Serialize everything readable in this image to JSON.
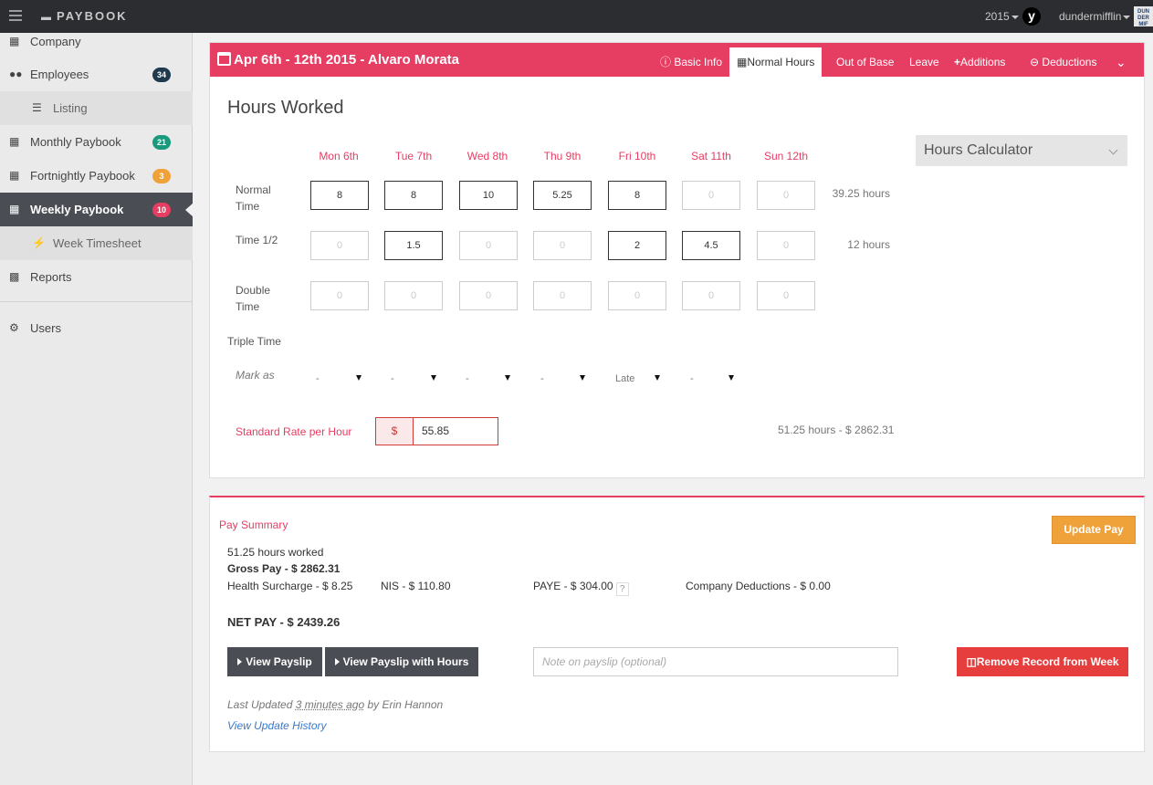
{
  "app": {
    "brand": "PAYBOOK",
    "year": "2015",
    "user": "dundermifflin",
    "company_logo_text": "DUNDER MIFFLIN"
  },
  "sidebar": {
    "items": [
      {
        "label": "Company",
        "icon": "building-icon"
      },
      {
        "label": "Employees",
        "icon": "users-icon",
        "badge": "34",
        "badge_color": "#1f3a4d"
      },
      {
        "label": "Listing",
        "icon": "list-icon"
      },
      {
        "label": "Monthly Paybook",
        "icon": "calendar-icon",
        "badge": "21",
        "badge_color": "#1a9a7c"
      },
      {
        "label": "Fortnightly Paybook",
        "icon": "calendar-icon",
        "badge": "3",
        "badge_color": "#f0a23a"
      },
      {
        "label": "Weekly Paybook",
        "icon": "calendar-icon",
        "badge": "10",
        "badge_color": "#e63d63"
      },
      {
        "label": "Week Timesheet",
        "icon": "bolt-icon"
      },
      {
        "label": "Reports",
        "icon": "bar-chart-icon"
      },
      {
        "label": "Users",
        "icon": "gear-icon"
      }
    ]
  },
  "header": {
    "title": "Apr 6th - 12th 2015 - Alvaro Morata",
    "tabs": [
      "Basic Info",
      "Normal Hours",
      "Out of Base",
      "Leave",
      "Additions",
      "Deductions"
    ],
    "active_tab": "Normal Hours"
  },
  "hours": {
    "title": "Hours Worked",
    "days": [
      "Mon 6th",
      "Tue 7th",
      "Wed 8th",
      "Thu 9th",
      "Fri 10th",
      "Sat 11th",
      "Sun 12th"
    ],
    "rows": [
      {
        "label": "Normal Time",
        "values": [
          "8",
          "8",
          "10",
          "5.25",
          "8",
          "0",
          "0"
        ],
        "total": "39.25 hours"
      },
      {
        "label": "Time 1/2",
        "values": [
          "0",
          "1.5",
          "0",
          "0",
          "2",
          "4.5",
          "0"
        ],
        "total": "12 hours"
      },
      {
        "label": "Double Time",
        "values": [
          "0",
          "0",
          "0",
          "0",
          "0",
          "0",
          "0"
        ],
        "total": ""
      }
    ],
    "triple_label": "Triple Time",
    "mark_label": "Mark as",
    "mark_values": [
      "-",
      "-",
      "-",
      "-",
      "Late",
      "-"
    ],
    "calculator": "Hours Calculator",
    "rate_label": "Standard Rate per Hour",
    "currency": "$",
    "rate": "55.85",
    "rate_total": "51.25 hours - $ 2862.31"
  },
  "summary": {
    "title": "Pay Summary",
    "update_label": "Update Pay",
    "hours_worked": "51.25 hours worked",
    "gross": "Gross Pay - $ 2862.31",
    "health": "Health Surcharge - $ 8.25",
    "nis": "NIS - $ 110.80",
    "paye": "PAYE - $ 304.00",
    "paye_help": "?",
    "company_deductions": "Company Deductions - $ 0.00",
    "net": "NET PAY - $ 2439.26",
    "view_payslip": "View Payslip",
    "view_payslip_hours": "View Payslip with Hours",
    "note_placeholder": "Note on payslip (optional)",
    "remove_label": "Remove Record from Week",
    "last_updated_pre": "Last Updated",
    "last_updated_time": "3 minutes ago",
    "last_updated_post": "by Erin Hannon",
    "history_link": "View Update History"
  }
}
